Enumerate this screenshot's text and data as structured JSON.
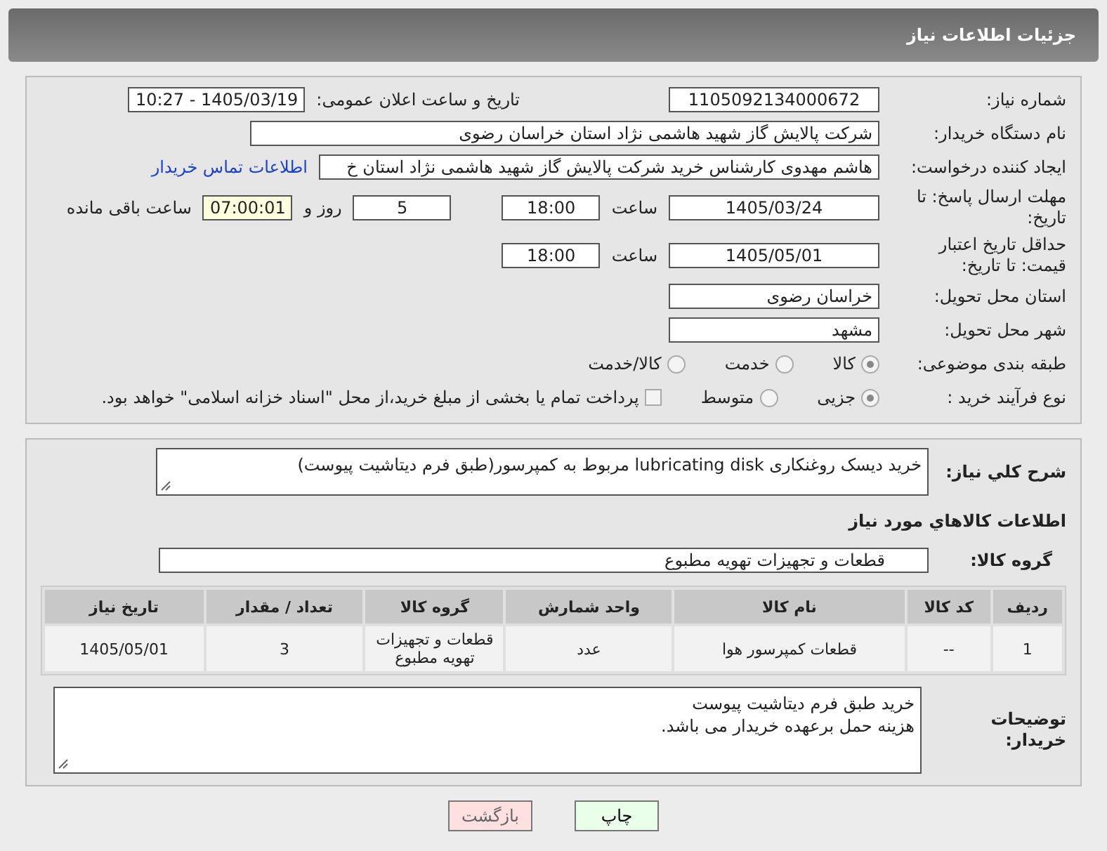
{
  "header": {
    "title": "جزئیات اطلاعات نیاز"
  },
  "need_number": {
    "label": "شماره نیاز:",
    "value": "1105092134000672"
  },
  "announce": {
    "label": "تاریخ و ساعت اعلان عمومی:",
    "value": "1405/03/19 - 10:27"
  },
  "buyer": {
    "label": "نام دستگاه خریدار:",
    "value": "شرکت پالایش گاز شهید هاشمی نژاد   استان خراسان رضوی"
  },
  "creator": {
    "label": "ایجاد کننده درخواست:",
    "value": "هاشم مهدوی کارشناس خرید شرکت پالایش گاز شهید هاشمی نژاد   استان خ",
    "link": "اطلاعات تماس خریدار"
  },
  "deadline": {
    "label": "مهلت ارسال پاسخ: تا تاریخ:",
    "date": "1405/03/24",
    "time_label": "ساعت",
    "time": "18:00",
    "days": "5",
    "days_label": "روز و",
    "remaining": "07:00:01",
    "remaining_label": "ساعت باقی مانده"
  },
  "validity": {
    "label": "حداقل تاریخ اعتبار قیمت: تا تاریخ:",
    "date": "1405/05/01",
    "time_label": "ساعت",
    "time": "18:00"
  },
  "province": {
    "label": "استان محل تحویل:",
    "value": "خراسان رضوی"
  },
  "city": {
    "label": "شهر محل تحویل:",
    "value": "مشهد"
  },
  "category": {
    "label": "طبقه بندی موضوعی:",
    "options": [
      {
        "label": "کالا",
        "selected": true
      },
      {
        "label": "خدمت",
        "selected": false
      },
      {
        "label": "کالا/خدمت",
        "selected": false
      }
    ]
  },
  "process": {
    "label": "نوع فرآیند خرید :",
    "options": [
      {
        "label": "جزیی",
        "selected": true
      },
      {
        "label": "متوسط",
        "selected": false
      }
    ],
    "treasury": {
      "checked": false,
      "label": "پرداخت تمام یا بخشی از مبلغ خرید،از محل \"اسناد خزانه اسلامی\" خواهد بود."
    }
  },
  "description": {
    "label": "شرح کلي نياز:",
    "value": "خرید دیسک روغنکاری lubricating disk مربوط به کمپرسور(طبق فرم دیتاشیت پیوست)"
  },
  "goods_heading": "اطلاعات کالاهاي مورد نياز",
  "goods_group": {
    "label": "گروه کالا:",
    "value": "قطعات و تجهیزات تهویه مطبوع"
  },
  "table": {
    "columns": [
      "ردیف",
      "کد کالا",
      "نام کالا",
      "واحد شمارش",
      "گروه کالا",
      "تعداد / مقدار",
      "تاریخ نیاز"
    ],
    "rows": [
      [
        "1",
        "--",
        "قطعات کمپرسور هوا",
        "عدد",
        "قطعات و تجهیزات تهویه مطبوع",
        "3",
        "1405/05/01"
      ]
    ]
  },
  "buyer_notes": {
    "label": "توضیحات خریدار:",
    "lines": [
      "خرید طبق فرم دیتاشیت پیوست",
      "هزینه حمل برعهده خریدار می باشد."
    ]
  },
  "buttons": [
    {
      "kind": "print",
      "label": "چاپ"
    },
    {
      "kind": "back",
      "label": "بازگشت"
    }
  ]
}
